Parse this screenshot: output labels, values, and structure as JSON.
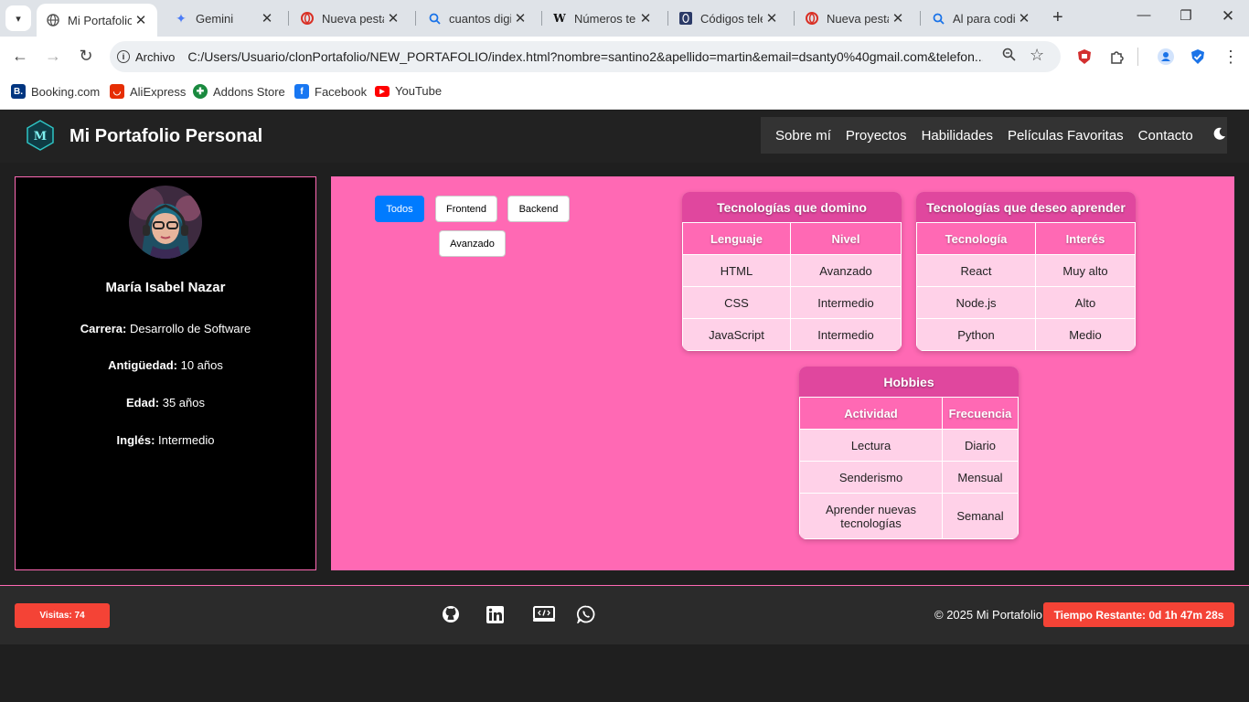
{
  "browser": {
    "tabs": [
      {
        "title": "Mi Portafolio",
        "icon": "globe-icon",
        "active": true
      },
      {
        "title": "Gemini",
        "icon": "gemini-icon",
        "active": false
      },
      {
        "title": "Nueva pesta",
        "icon": "opera-icon",
        "active": false
      },
      {
        "title": "cuantos digi",
        "icon": "search-icon",
        "active": false
      },
      {
        "title": "Números tel",
        "icon": "wikipedia-icon",
        "active": false
      },
      {
        "title": "Códigos tele",
        "icon": "site-icon",
        "active": false
      },
      {
        "title": "Nueva pesta",
        "icon": "opera-icon",
        "active": false
      },
      {
        "title": "Al para codi",
        "icon": "search-icon",
        "active": false
      }
    ],
    "address": {
      "chip_label": "Archivo",
      "url": "C:/Users/Usuario/clonPortafolio/NEW_PORTAFOLIO/index.html?nombre=santino2&apellido=martin&email=dsanty0%40gmail.com&telefon..."
    },
    "bookmarks": [
      {
        "label": "Booking.com",
        "icon": "booking-icon",
        "color": "#003580"
      },
      {
        "label": "AliExpress",
        "icon": "aliexpress-icon",
        "color": "#e62e04"
      },
      {
        "label": "Addons Store",
        "icon": "addons-icon",
        "color": "#1a8a3f"
      },
      {
        "label": "Facebook",
        "icon": "facebook-icon",
        "color": "#1877f2"
      },
      {
        "label": "YouTube",
        "icon": "youtube-icon",
        "color": "#ff0000"
      }
    ]
  },
  "site": {
    "title": "Mi Portafolio Personal",
    "nav": [
      "Sobre mí",
      "Proyectos",
      "Habilidades",
      "Películas Favoritas",
      "Contacto"
    ],
    "theme_toggle_icon": "moon-icon"
  },
  "profile": {
    "name": "María Isabel Nazar",
    "fields": [
      {
        "label": "Carrera:",
        "value": "Desarrollo de Software"
      },
      {
        "label": "Antigüedad:",
        "value": "10 años"
      },
      {
        "label": "Edad:",
        "value": "35 años"
      },
      {
        "label": "Inglés:",
        "value": "Intermedio"
      }
    ]
  },
  "filters": {
    "buttons": [
      "Todos",
      "Frontend",
      "Backend",
      "Avanzado"
    ],
    "active": "Todos"
  },
  "tables": {
    "domino": {
      "caption": "Tecnologías que domino",
      "headers": [
        "Lenguaje",
        "Nivel"
      ],
      "rows": [
        [
          "HTML",
          "Avanzado"
        ],
        [
          "CSS",
          "Intermedio"
        ],
        [
          "JavaScript",
          "Intermedio"
        ]
      ]
    },
    "aprender": {
      "caption": "Tecnologías que deseo aprender",
      "headers": [
        "Tecnología",
        "Interés"
      ],
      "rows": [
        [
          "React",
          "Muy alto"
        ],
        [
          "Node.js",
          "Alto"
        ],
        [
          "Python",
          "Medio"
        ]
      ]
    },
    "hobbies": {
      "caption": "Hobbies",
      "headers": [
        "Actividad",
        "Frecuencia"
      ],
      "rows": [
        [
          "Lectura",
          "Diario"
        ],
        [
          "Senderismo",
          "Mensual"
        ],
        [
          "Aprender nuevas tecnologías",
          "Semanal"
        ]
      ]
    }
  },
  "footer": {
    "visits": "Visitas: 74",
    "social": [
      "github-icon",
      "linkedin-icon",
      "portfolio-icon",
      "whatsapp-icon"
    ],
    "copyright": "© 2025 Mi Portafolio",
    "timer": "Tiempo Restante: 0d 1h 47m 28s"
  },
  "colors": {
    "accent_pink": "#ff69b4",
    "caption_pink": "#e0479e",
    "active_button": "#007bff",
    "badge_red": "#f44336"
  }
}
